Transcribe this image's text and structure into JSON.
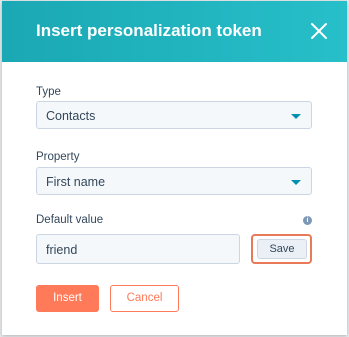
{
  "dialog": {
    "title": "Insert personalization token",
    "close_icon": "close-icon"
  },
  "fields": {
    "type": {
      "label": "Type",
      "value": "Contacts"
    },
    "property": {
      "label": "Property",
      "value": "First name"
    },
    "default_value": {
      "label": "Default value",
      "value": "friend",
      "info_icon": "info-icon"
    }
  },
  "buttons": {
    "save": "Save",
    "insert": "Insert",
    "cancel": "Cancel"
  },
  "colors": {
    "header": "#1aa8b4",
    "primary": "#ff7a59",
    "highlight": "#e87a5a",
    "text": "#33475b",
    "link": "#0091ae"
  }
}
